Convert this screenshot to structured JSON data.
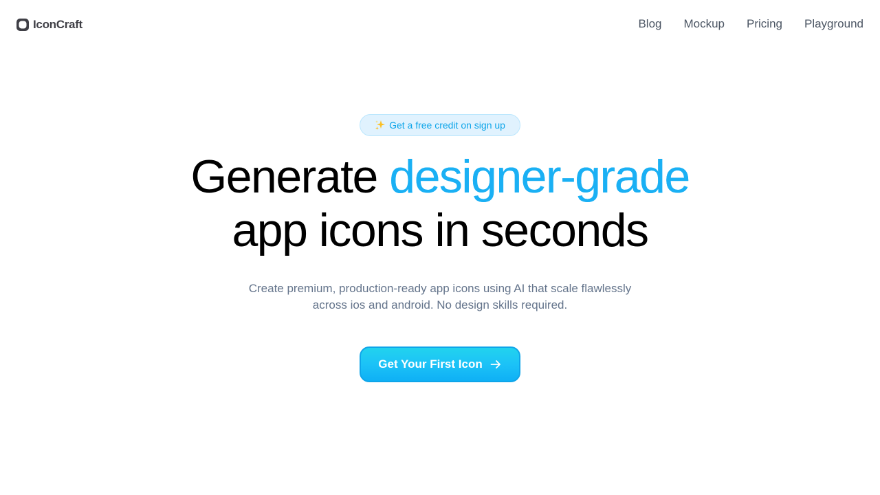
{
  "header": {
    "logo_text": "IconCraft",
    "nav": [
      {
        "label": "Blog"
      },
      {
        "label": "Mockup"
      },
      {
        "label": "Pricing"
      },
      {
        "label": "Playground"
      }
    ]
  },
  "hero": {
    "badge_text": "Get a free credit on sign up",
    "headline_prefix": "Generate ",
    "headline_accent": "designer-grade",
    "headline_line2": "app icons in seconds",
    "subtitle_line1": "Create premium, production-ready app icons using AI that scale flawlessly",
    "subtitle_line2": "across ios and android. No design skills required.",
    "cta_label": "Get Your First Icon"
  },
  "icons": {
    "logo": "rounded-square-logo-icon",
    "badge": "sparkles-icon",
    "cta": "arrow-right-icon"
  },
  "colors": {
    "accent": "#0ea5e9",
    "text_primary": "#000000",
    "text_muted": "#64748b",
    "nav_text": "#4b5563",
    "badge_bg": "#e0f2fe"
  }
}
